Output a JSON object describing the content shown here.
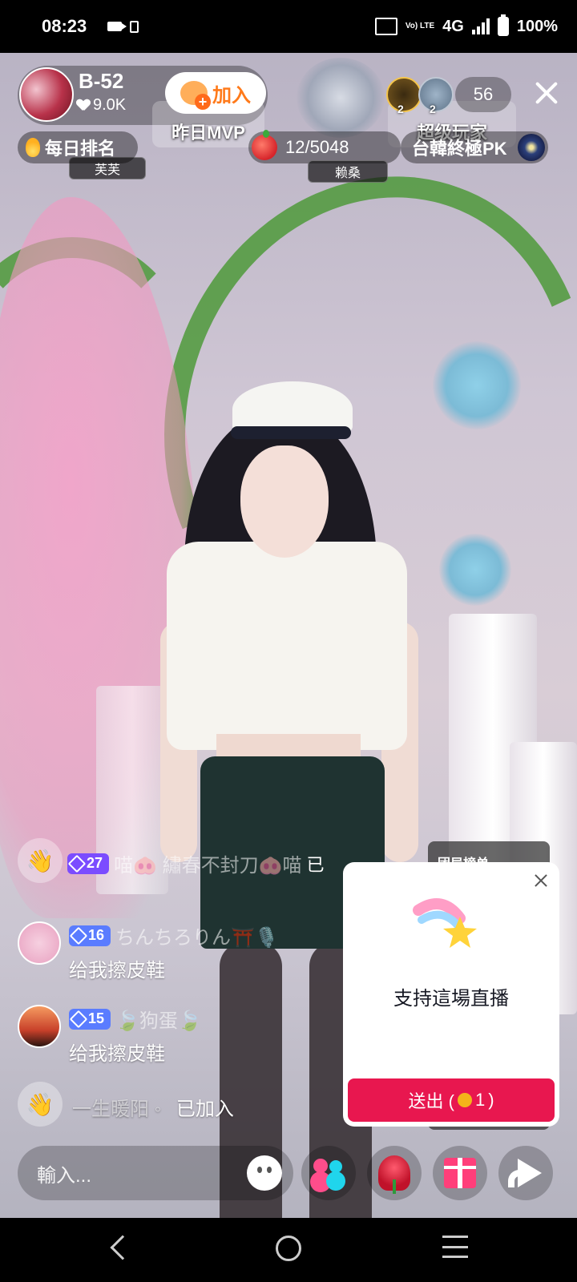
{
  "status_bar": {
    "time": "08:23",
    "network": "4G",
    "volte": "Vo) LTE",
    "battery": "100%"
  },
  "host": {
    "name": "B-52",
    "likes": "9.0K",
    "join_label": "加入"
  },
  "badges": {
    "mvp_label": "昨日MVP",
    "super_player_label": "超级玩家",
    "mvp_tag": "芙芙",
    "player_tag": "赖桑"
  },
  "viewers": {
    "top_levels": [
      "2",
      "2"
    ],
    "count": "56"
  },
  "ranking": {
    "daily_rank_label": "每日排名",
    "fruit_progress": "12/5048",
    "pk_label": "台韓終極PK"
  },
  "chat": [
    {
      "type": "join",
      "level": "27",
      "name": "喵🐽 繡春不封刀🐽喵",
      "text": "已"
    },
    {
      "type": "message",
      "level": "16",
      "name": "ちんちろりん⛩️🎙️",
      "text": "给我擦皮鞋"
    },
    {
      "type": "message",
      "level": "15",
      "name": "🍃狗蛋🍃",
      "text": "给我擦皮鞋"
    },
    {
      "type": "join",
      "name": "一生暖阳 ◦",
      "text": "已加入"
    }
  ],
  "team_panel": {
    "title": "团局榜单"
  },
  "gift_popup": {
    "title": "支持這場直播",
    "send_label": "送出 (",
    "send_amount": "1",
    "send_suffix": ")"
  },
  "bottom_bar": {
    "input_placeholder": "輸入..."
  },
  "icons": {
    "emoji": "emoji-icon",
    "team": "team-icon",
    "rose": "rose-icon",
    "gift": "gift-icon",
    "share": "share-icon"
  },
  "colors": {
    "accent": "#e8174f",
    "join_orange": "#ff7a1a",
    "level_blue": "#5a7cff",
    "level_purple": "#7b4cff"
  }
}
